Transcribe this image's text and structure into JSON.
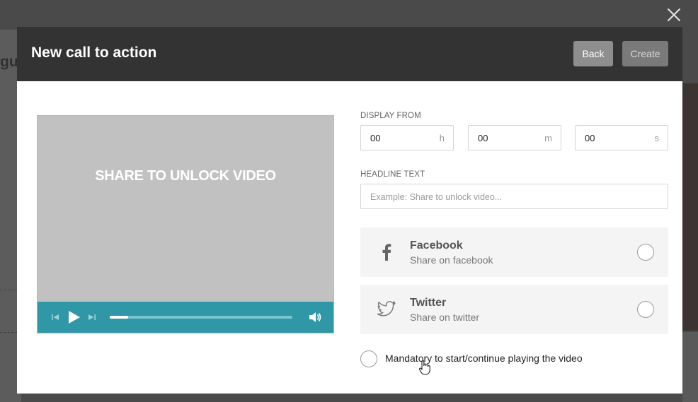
{
  "background": {
    "partial_word": "gu"
  },
  "modal": {
    "title": "New call to action",
    "back_label": "Back",
    "create_label": "Create",
    "close_icon": "close-icon"
  },
  "player": {
    "headline": "SHARE TO UNLOCK VIDEO",
    "progress": 0.1,
    "controls_color": "#2f97a6"
  },
  "display_from": {
    "label": "DISPLAY FROM",
    "hours": {
      "value": "00",
      "unit": "h"
    },
    "minutes": {
      "value": "00",
      "unit": "m"
    },
    "seconds": {
      "value": "00",
      "unit": "s"
    }
  },
  "headline_text": {
    "label": "HEADLINE TEXT",
    "placeholder": "Example: Share to unlock video..."
  },
  "share_options": [
    {
      "name": "Facebook",
      "desc": "Share on facebook",
      "icon": "facebook-icon",
      "selected": false
    },
    {
      "name": "Twitter",
      "desc": "Share on twitter",
      "icon": "twitter-icon",
      "selected": false
    }
  ],
  "mandatory": {
    "label": "Mandatory to start/continue playing the video",
    "checked": false
  }
}
